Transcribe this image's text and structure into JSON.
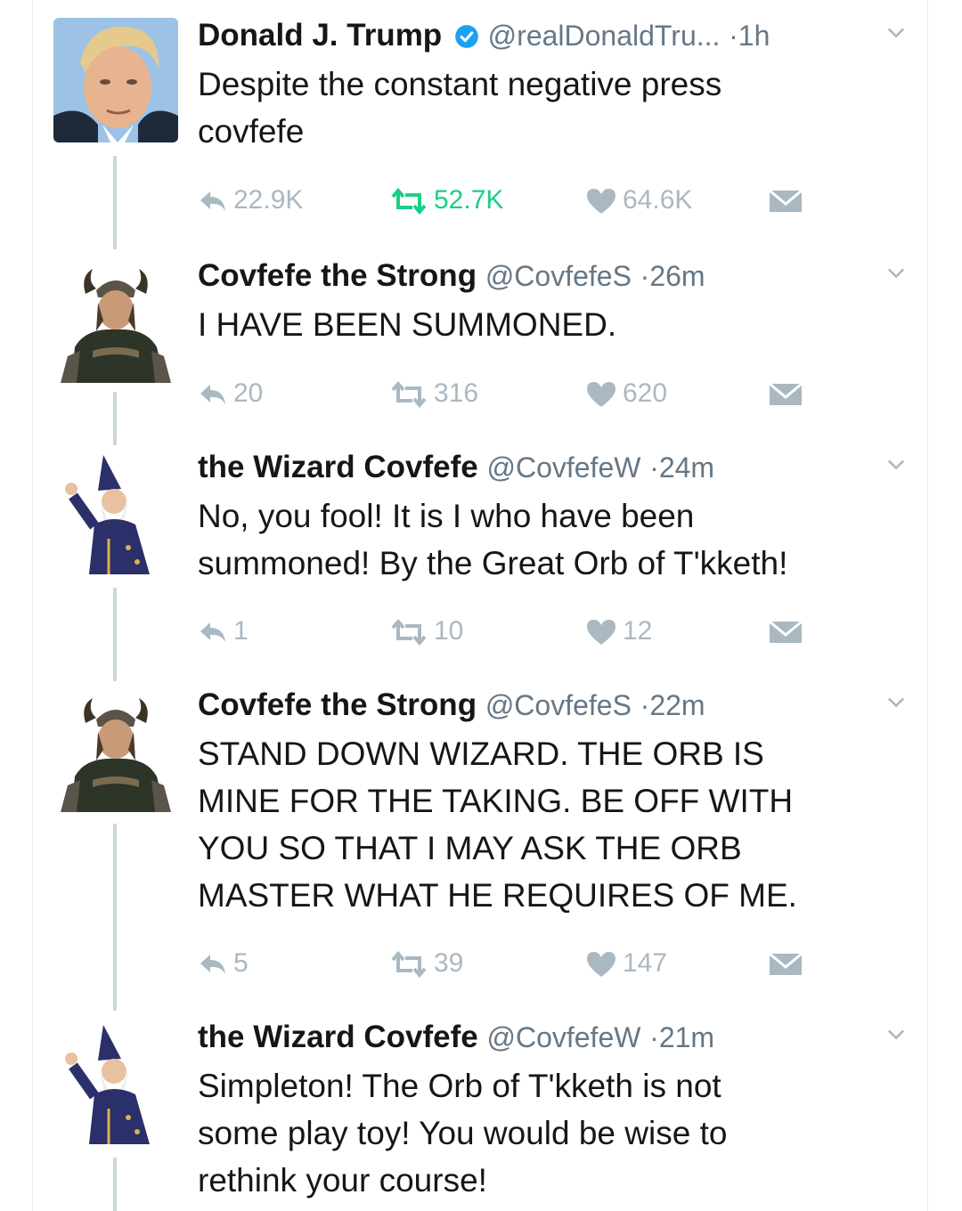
{
  "colors": {
    "verified": "#1da1f2",
    "retweeted": "#19cf86",
    "muted": "#aab8c2",
    "handle": "#657786",
    "thread_line": "#ccd6dd"
  },
  "tweets": [
    {
      "name": "Donald J. Trump",
      "verified": true,
      "handle": "@realDonaldTru...",
      "dot": "·",
      "time": "1h",
      "text": "Despite the constant negative press\ncovfefe",
      "replies": "22.9K",
      "retweets": "52.7K",
      "likes": "64.6K",
      "retweeted": true,
      "avatar_icon": "trump-avatar"
    },
    {
      "name": "Covfefe the Strong",
      "verified": false,
      "handle": "@CovfefeS",
      "dot": "·",
      "time": "26m",
      "text": "I HAVE BEEN SUMMONED.",
      "replies": "20",
      "retweets": "316",
      "likes": "620",
      "retweeted": false,
      "avatar_icon": "viking-avatar"
    },
    {
      "name": "the Wizard Covfefe",
      "verified": false,
      "handle": "@CovfefeW",
      "dot": "·",
      "time": "24m",
      "text": "No, you fool! It is I who have been\nsummoned! By the Great Orb of T'kketh!",
      "replies": "1",
      "retweets": "10",
      "likes": "12",
      "retweeted": false,
      "avatar_icon": "wizard-avatar"
    },
    {
      "name": "Covfefe the Strong",
      "verified": false,
      "handle": "@CovfefeS",
      "dot": "·",
      "time": "22m",
      "text": "STAND DOWN WIZARD. THE ORB IS\nMINE FOR THE TAKING. BE OFF WITH\nYOU SO THAT I MAY ASK THE ORB\nMASTER WHAT HE REQUIRES OF ME.",
      "replies": "5",
      "retweets": "39",
      "likes": "147",
      "retweeted": false,
      "avatar_icon": "viking-avatar"
    },
    {
      "name": "the Wizard Covfefe",
      "verified": false,
      "handle": "@CovfefeW",
      "dot": "·",
      "time": "21m",
      "text": "Simpleton! The Orb of T'kketh is not\nsome play toy! You would be wise to\nrethink your course!",
      "replies": "",
      "retweets": "",
      "likes": "",
      "retweeted": false,
      "avatar_icon": "wizard-avatar"
    }
  ]
}
